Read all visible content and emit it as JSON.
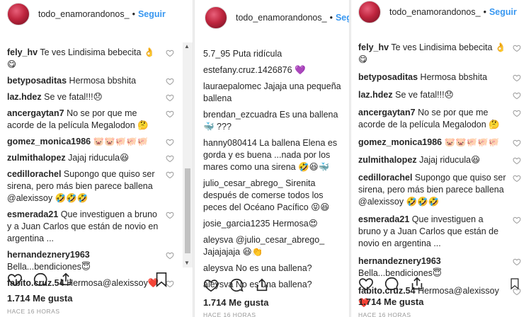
{
  "panels": [
    {
      "username": "todo_enamorandonos_",
      "dot": "•",
      "follow": "Seguir",
      "comments": [
        {
          "user": "fely_hv",
          "text": "Te ves Lindisima bebecita 👌😋"
        },
        {
          "user": "betyposaditas",
          "text": "Hermosa bbshita"
        },
        {
          "user": "laz.hdez",
          "text": "Se ve fatal!!!😞"
        },
        {
          "user": "ancergaytan7",
          "text": "No se por que me acorde de la película Megalodon 🤔"
        },
        {
          "user": "gomez_monica1986",
          "text": "🐷🐷🐖🐖🐖"
        },
        {
          "user": "zulmithalopez",
          "text": "Jajaj riducula😆"
        },
        {
          "user": "cedillorachel",
          "text": "Supongo que quiso ser sirena, pero más bien parece ballena @alexissoy 🤣🤣🤣"
        },
        {
          "user": "esmerada21",
          "text": "Que investiguen a bruno y a Juan Carlos que están de novio en argentina ..."
        },
        {
          "user": "hernandeznery1963",
          "text": "Bella...bendiciones😇"
        },
        {
          "user": "fabito.cruz.54",
          "text": "Hermosa@alexissoy❤️"
        }
      ],
      "likes": "1.714 Me gusta",
      "time": "HACE 16 HORAS"
    },
    {
      "username": "todo_enamorandonos_",
      "dot": "•",
      "follow": "Seg",
      "comments": [
        {
          "user": "5.7_95",
          "text": "Puta ridícula"
        },
        {
          "user": "estefany.cruz.1426876",
          "text": "💜"
        },
        {
          "user": "lauraepalomec",
          "text": "Jajaja una pequeña ballena"
        },
        {
          "user": "brendan_ezcuadra",
          "text": "Es una ballena🐳 ???"
        },
        {
          "user": "hanny080414",
          "text": "La ballena Elena es gorda y es buena ...nada por los mares como una sirena 🤣😆🐳"
        },
        {
          "user": "julio_cesar_abrego_",
          "text": "Sirenita después de comerse todos los peces del Océano Pacífico 😝😆"
        },
        {
          "user": "josie_garcia1235",
          "text": "Hermosa😍"
        },
        {
          "user": "aleysva",
          "text": "@julio_cesar_abrego_ Jajajajaja 😆👏"
        },
        {
          "user": "aleysva",
          "text": "No es una ballena?"
        },
        {
          "user": "aleysva",
          "text": "No es una ballena?"
        }
      ],
      "likes": "1.714 Me gusta",
      "time": "HACE 16 HORAS"
    },
    {
      "username": "todo_enamorandonos_",
      "dot": "•",
      "follow": "Seguir",
      "comments": [
        {
          "user": "fely_hv",
          "text": "Te ves Lindisima bebecita 👌😋"
        },
        {
          "user": "betyposaditas",
          "text": "Hermosa bbshita"
        },
        {
          "user": "laz.hdez",
          "text": "Se ve fatal!!!😞"
        },
        {
          "user": "ancergaytan7",
          "text": "No se por que me acorde de la película Megalodon 🤔"
        },
        {
          "user": "gomez_monica1986",
          "text": "🐷🐷🐖🐖🐖"
        },
        {
          "user": "zulmithalopez",
          "text": "Jajaj riducula😆"
        },
        {
          "user": "cedillorachel",
          "text": "Supongo que quiso ser sirena, pero más bien parece ballena @alexissoy 🤣🤣🤣"
        },
        {
          "user": "esmerada21",
          "text": "Que investiguen a bruno y a Juan Carlos que están de novio en argentina ..."
        },
        {
          "user": "hernandeznery1963",
          "text": "Bella...bendiciones😇"
        },
        {
          "user": "fabito.cruz.54",
          "text": "Hermosa@alexissoy❤️"
        }
      ],
      "likes": "1.714 Me gusta",
      "time": "HACE 16 HORAS"
    }
  ],
  "icons": [
    "heart-icon",
    "comment-icon",
    "share-icon",
    "bookmark-icon",
    "like-comment-icon"
  ],
  "colors": {
    "follow": "#3897f0",
    "text": "#262626",
    "muted": "#999999",
    "icon": "#999999"
  }
}
